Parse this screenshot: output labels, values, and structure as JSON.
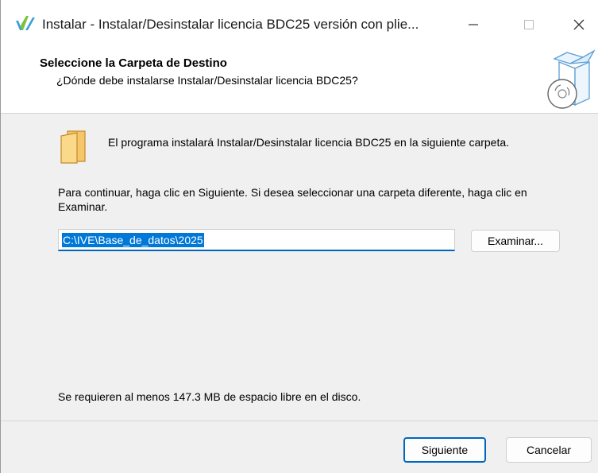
{
  "window": {
    "title": "Instalar - Instalar/Desinstalar licencia BDC25 versión con plie...",
    "minimize_label": "—",
    "maximize_label": "☐",
    "close_label": "✕"
  },
  "header": {
    "title": "Seleccione la Carpeta de Destino",
    "subtitle": "¿Dónde debe instalarse Instalar/Desinstalar licencia BDC25?"
  },
  "content": {
    "install_message": "El programa instalará Instalar/Desinstalar licencia BDC25 en la siguiente carpeta.",
    "continue_message": "Para continuar, haga clic en Siguiente. Si desea seleccionar una carpeta diferente, haga clic en Examinar.",
    "path_value": "C:\\IVE\\Base_de_datos\\2025",
    "browse_label": "Examinar...",
    "space_message": "Se requieren al menos 147.3 MB de espacio libre en el disco."
  },
  "footer": {
    "next_label": "Siguiente",
    "cancel_label": "Cancelar"
  },
  "icons": {
    "app": "installer-app-icon",
    "header": "box-cd-icon",
    "folder": "folder-icon"
  }
}
